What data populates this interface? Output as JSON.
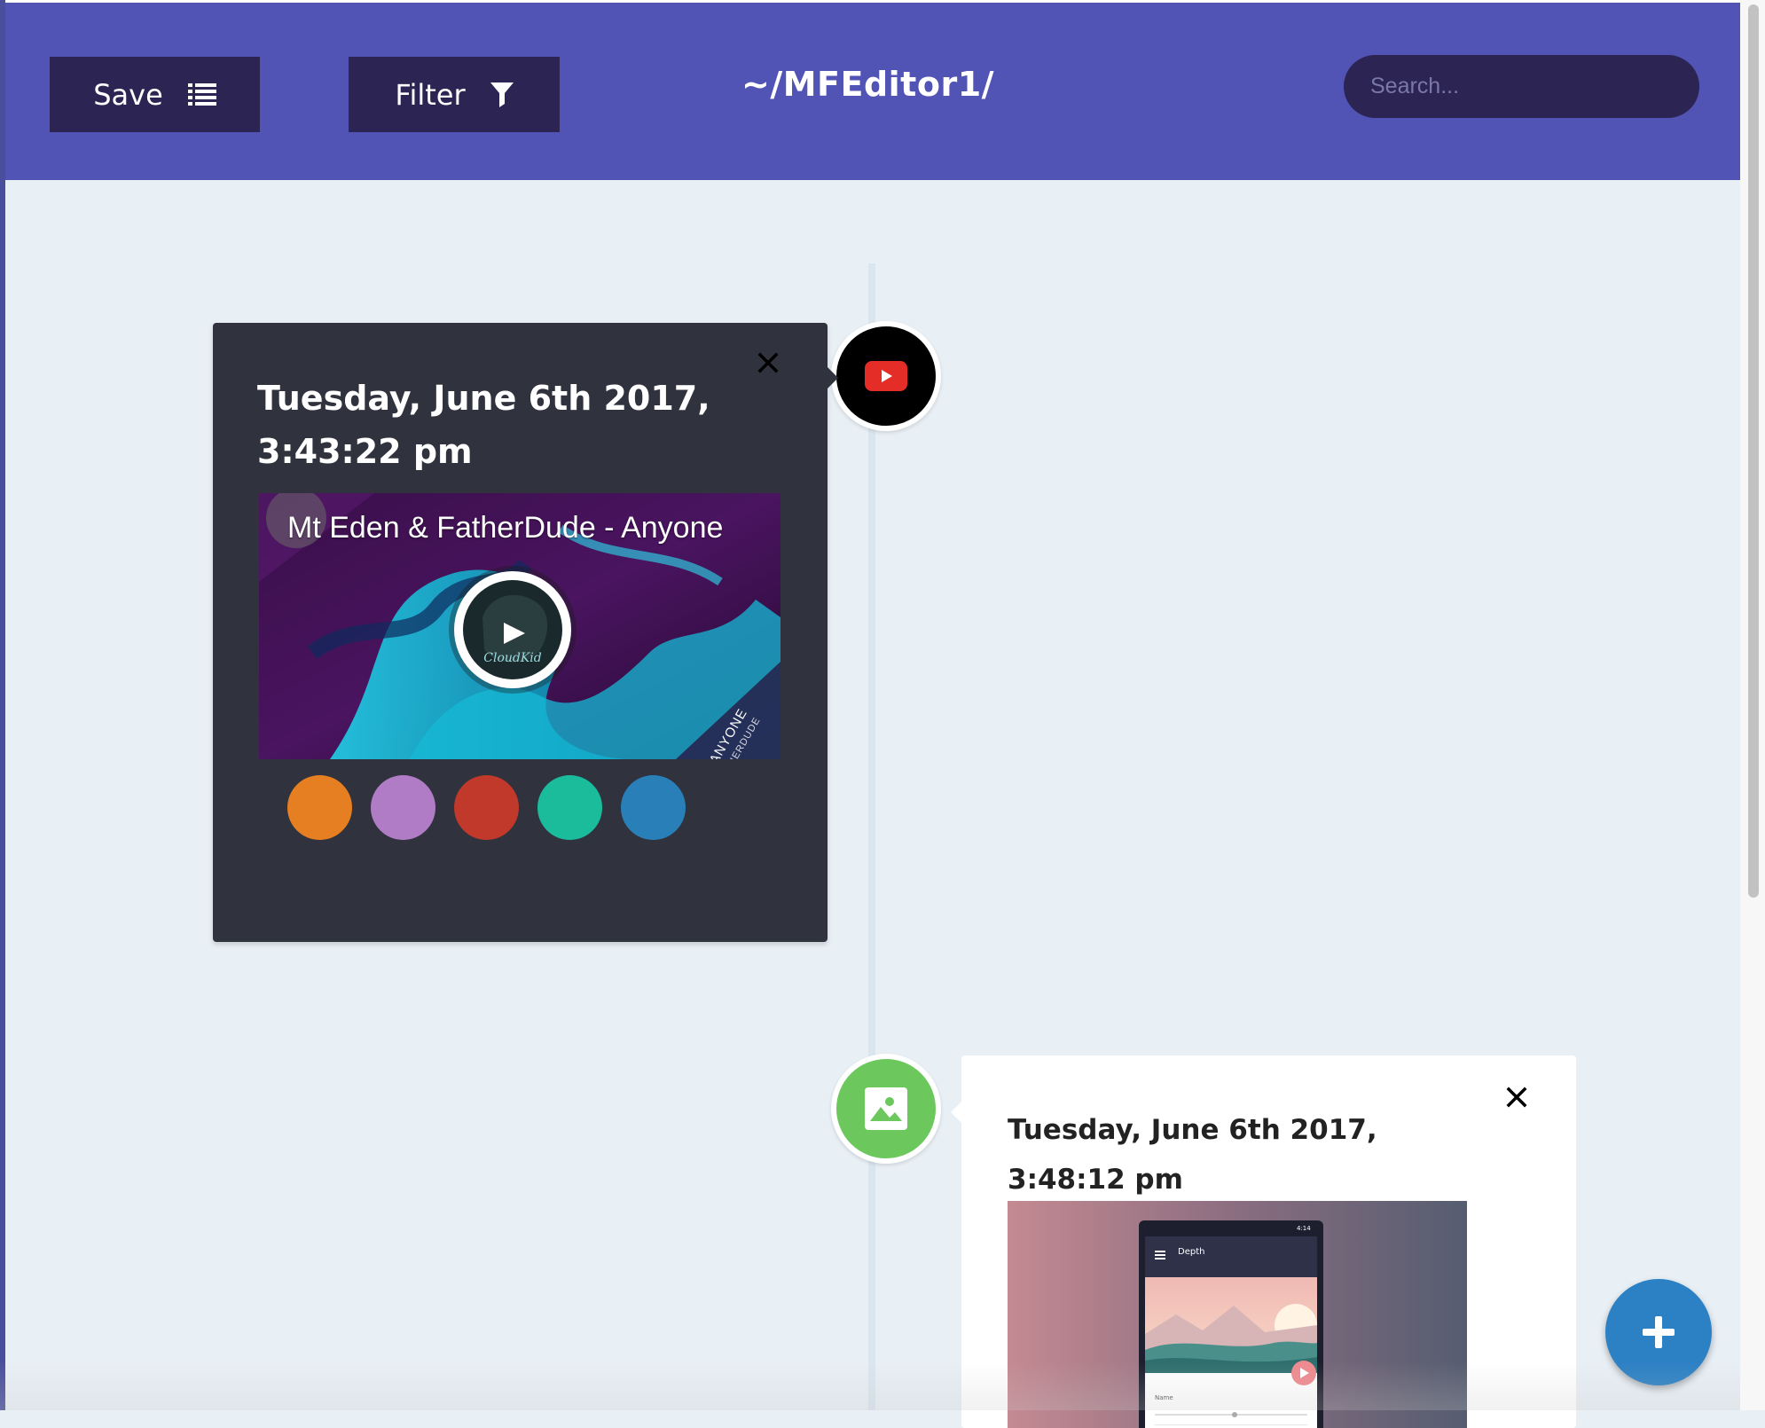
{
  "header": {
    "save_label": "Save",
    "filter_label": "Filter",
    "title": "~/MFEditor1/",
    "search_placeholder": "Search...",
    "bg_color": "#5153b5",
    "button_color": "#2c2453"
  },
  "timeline": {
    "entries": [
      {
        "type": "video",
        "node_icon": "youtube-icon",
        "date": "Tuesday, June 6th 2017, 3:43:22 pm",
        "video_title": "Mt Eden & FatherDude - Anyone",
        "thumbnail_text": "ANYONE",
        "thumbnail_subtext": "MT EDEN X FATHERDUDE",
        "swatches": [
          "#e67e22",
          "#b07cc6",
          "#c0392b",
          "#1abc9c",
          "#2980b9"
        ]
      },
      {
        "type": "image",
        "node_icon": "image-icon",
        "date": "Tuesday, June 6th 2017, 3:48:12 pm",
        "image_app_title": "Depth",
        "image_status_time": "4:14",
        "image_field_label": "Name"
      }
    ]
  },
  "fab": {
    "icon": "plus-icon",
    "color": "#2c80c4"
  }
}
